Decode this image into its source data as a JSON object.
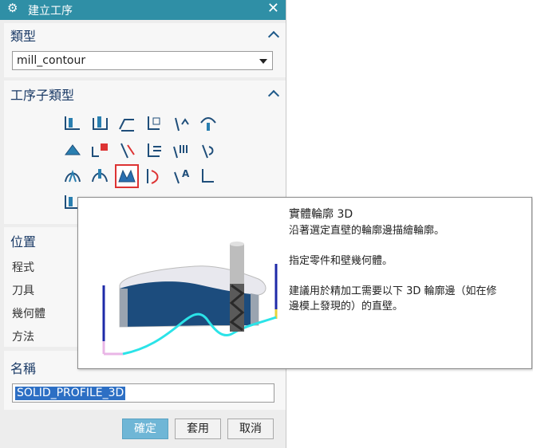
{
  "window": {
    "title": "建立工序"
  },
  "type_section": {
    "header": "類型",
    "selected": "mill_contour"
  },
  "subtype_section": {
    "header": "工序子類型"
  },
  "subtype_icons": [
    "mill-icon-1",
    "mill-icon-2",
    "mill-icon-3",
    "mill-icon-4",
    "mill-icon-5",
    "mill-icon-6",
    "mill-icon-7",
    "mill-icon-8",
    "mill-icon-9",
    "mill-icon-10",
    "mill-icon-11",
    "mill-icon-12",
    "mill-icon-13",
    "mill-icon-14",
    "solid-profile-3d-icon",
    "mill-icon-16",
    "mill-icon-17",
    "mill-icon-18"
  ],
  "position_section": {
    "header": "位置",
    "fields": [
      "程式",
      "刀具",
      "幾何體",
      "方法"
    ]
  },
  "name_section": {
    "header": "名稱",
    "value": "SOLID_PROFILE_3D"
  },
  "buttons": {
    "ok": "確定",
    "apply": "套用",
    "cancel": "取消"
  },
  "tooltip": {
    "title": "實體輪廓 3D",
    "line1": "沿著選定直壁的輪廓邊描繪輪廓。",
    "line2": "指定零件和壁幾何體。",
    "line3": "建議用於精加工需要以下 3D 輪廓邊（如在修",
    "line4": "邊模上發現的）的直壁。"
  },
  "colors": {
    "titlebar": "#2f8fa6",
    "accent": "#1a3a66",
    "primary_button": "#6fb6d6"
  }
}
